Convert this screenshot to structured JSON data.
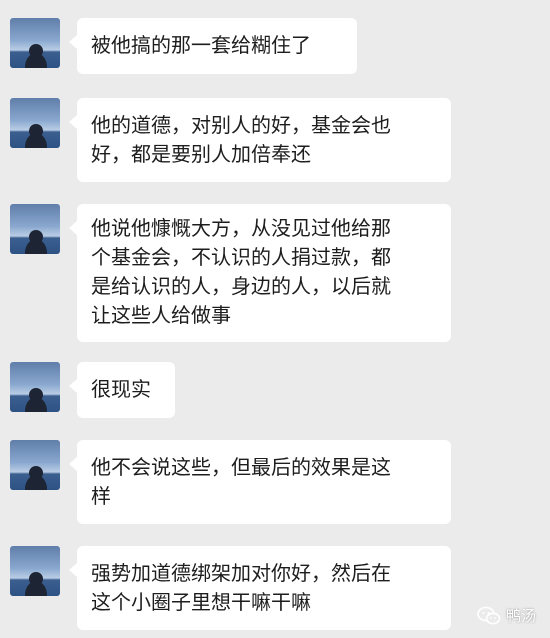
{
  "chat": {
    "messages": [
      {
        "text": "被他搞的那一套给糊住了",
        "avatar_icon": "avatar-icon"
      },
      {
        "text": "他的道德，对别人的好，基金会也\n好，都是要别人加倍奉还",
        "avatar_icon": "avatar-icon"
      },
      {
        "text": "他说他慷慨大方，从没见过他给那\n个基金会，不认识的人捐过款，都\n是给认识的人，身边的人，以后就\n让这些人给做事",
        "avatar_icon": "avatar-icon"
      },
      {
        "text": "很现实",
        "avatar_icon": "avatar-icon"
      },
      {
        "text": "他不会说这些，但最后的效果是这\n样",
        "avatar_icon": "avatar-icon"
      },
      {
        "text": "强势加道德绑架加对你好，然后在\n这个小圈子里想干嘛干嘛",
        "avatar_icon": "avatar-icon"
      }
    ]
  },
  "watermark": {
    "text": "鸭汤",
    "icon": "wechat-icon"
  },
  "colors": {
    "background": "#ebebeb",
    "bubble": "#ffffff",
    "text": "#1d1d1d"
  }
}
